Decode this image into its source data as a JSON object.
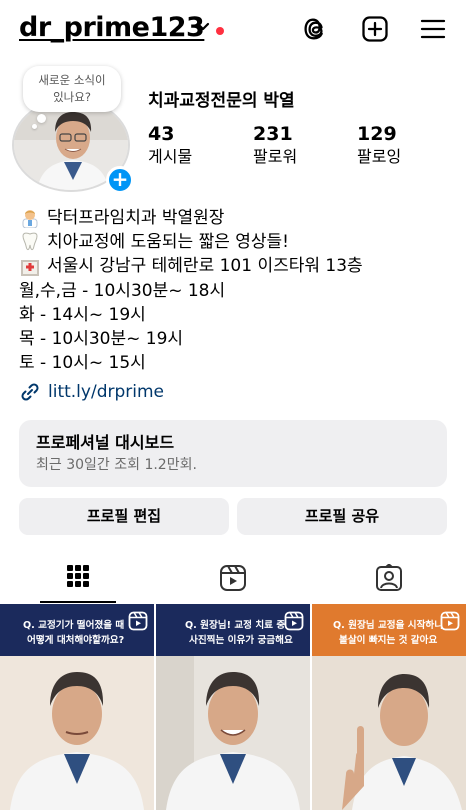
{
  "header": {
    "username": "dr_prime123",
    "icons": [
      "chevron-down-icon",
      "threads-icon",
      "new-post-icon",
      "menu-icon"
    ],
    "notification_dot_color": "#ff3040"
  },
  "profile": {
    "note_bubble": "새로운 소식이 있나요?",
    "display_name": "치과교정전문의 박열",
    "stats": [
      {
        "value": "43",
        "label": "게시물"
      },
      {
        "value": "231",
        "label": "팔로워"
      },
      {
        "value": "129",
        "label": "팔로잉"
      }
    ],
    "bio": [
      {
        "icon": "doctor-emoji-icon",
        "text": "닥터프라임치과 박열원장"
      },
      {
        "icon": "tooth-emoji-icon",
        "text": "치아교정에 도움되는 짧은 영상들!"
      },
      {
        "icon": "hospital-emoji-icon",
        "text": "서울시 강남구 테헤란로 101 이즈타워 13층"
      },
      {
        "icon": "",
        "text": "월,수,금 - 10시30분~ 18시"
      },
      {
        "icon": "",
        "text": "화 - 14시~ 19시"
      },
      {
        "icon": "",
        "text": "목 - 10시30분~ 19시"
      },
      {
        "icon": "",
        "text": "토 - 10시~ 15시"
      }
    ],
    "link": "litt.ly/drprime",
    "link_color": "#00376b"
  },
  "dashboard": {
    "title": "프로페셔널 대시보드",
    "subtitle": "최근 30일간 조회 1.2만회."
  },
  "buttons": {
    "edit_profile": "프로필 편집",
    "share_profile": "프로필 공유"
  },
  "tabs": [
    {
      "icon": "grid-icon",
      "active": true
    },
    {
      "icon": "reels-icon",
      "active": false
    },
    {
      "icon": "tagged-icon",
      "active": false
    }
  ],
  "posts": [
    {
      "caption_line1": "Q. 교정기가 떨어졌을 때",
      "caption_line2": "어떻게 대처해야할까요?",
      "banner_color": "#1b2a5c"
    },
    {
      "caption_line1": "Q. 원장님! 교정 치료 중",
      "caption_line2": "사진찍는 이유가 궁금해요",
      "banner_color": "#1b2a5c"
    },
    {
      "caption_line1": "Q. 원장님 교정을 시작하니",
      "caption_line2": "볼살이 빠지는 것 같아요",
      "banner_color": "#e07a2e"
    }
  ]
}
